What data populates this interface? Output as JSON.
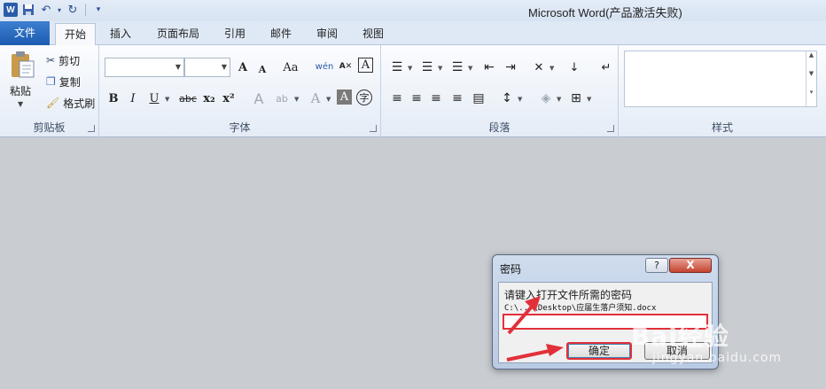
{
  "window": {
    "title": "Microsoft Word(产品激活失败)"
  },
  "quick_access": {
    "app_icon": "W"
  },
  "tabs": [
    {
      "label": "文件"
    },
    {
      "label": "开始"
    },
    {
      "label": "插入"
    },
    {
      "label": "页面布局"
    },
    {
      "label": "引用"
    },
    {
      "label": "邮件"
    },
    {
      "label": "审阅"
    },
    {
      "label": "视图"
    }
  ],
  "clipboard": {
    "paste": "粘贴",
    "cut": "剪切",
    "copy": "复制",
    "format_painter": "格式刷",
    "group_label": "剪贴板"
  },
  "font": {
    "grow": "A",
    "shrink": "A",
    "bold": "B",
    "italic": "I",
    "underline": "U",
    "strike": "abc",
    "sub": "x₂",
    "sup": "x²",
    "clear_format": "Aa",
    "char_border": "A",
    "char_shade": "A",
    "enclose": "字",
    "group_label": "字体"
  },
  "paragraph": {
    "group_label": "段落"
  },
  "styles": {
    "group_label": "样式"
  },
  "dialog": {
    "title": "密码",
    "help": "?",
    "close": "X",
    "prompt": "请键入打开文件所需的密码",
    "path": "C:\\...\\Desktop\\应届生落户须知.docx",
    "password_value": "",
    "ok": "确定",
    "cancel": "取消"
  },
  "watermark": {
    "brand": "Bai经验",
    "url": "jingyan.baidu.com"
  },
  "colors": {
    "annotation_red": "#e2303a",
    "file_tab": "#2a66bd"
  }
}
